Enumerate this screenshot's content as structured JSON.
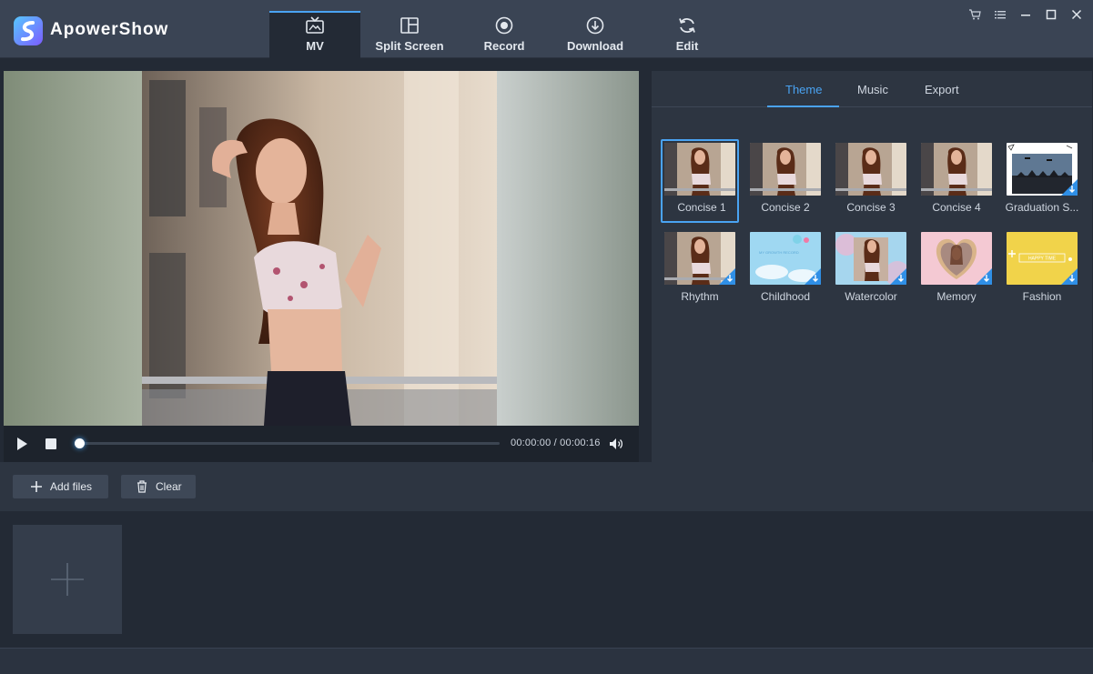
{
  "app": {
    "brand": "ApowerShow",
    "accent": "#4aa3f2"
  },
  "nav": {
    "tabs": [
      {
        "label": "MV",
        "icon": "tv-icon",
        "active": true
      },
      {
        "label": "Split Screen",
        "icon": "split-screen-icon",
        "active": false
      },
      {
        "label": "Record",
        "icon": "record-icon",
        "active": false
      },
      {
        "label": "Download",
        "icon": "download-icon",
        "active": false
      },
      {
        "label": "Edit",
        "icon": "refresh-icon",
        "active": false
      }
    ]
  },
  "window_controls": [
    "cart-icon",
    "menu-icon",
    "minimize-icon",
    "maximize-icon",
    "close-icon"
  ],
  "player": {
    "current_time": "00:00:00",
    "total_time": "00:00:16",
    "time_display": "00:00:00 / 00:00:16",
    "progress": 0
  },
  "panel": {
    "tabs": [
      {
        "label": "Theme",
        "active": true
      },
      {
        "label": "Music",
        "active": false
      },
      {
        "label": "Export",
        "active": false
      }
    ],
    "themes": [
      {
        "label": "Concise 1",
        "selected": true,
        "download": false
      },
      {
        "label": "Concise 2",
        "selected": false,
        "download": false
      },
      {
        "label": "Concise 3",
        "selected": false,
        "download": false
      },
      {
        "label": "Concise 4",
        "selected": false,
        "download": false
      },
      {
        "label": "Graduation S...",
        "selected": false,
        "download": true
      },
      {
        "label": "Rhythm",
        "selected": false,
        "download": true
      },
      {
        "label": "Childhood",
        "selected": false,
        "download": true
      },
      {
        "label": "Watercolor",
        "selected": false,
        "download": true
      },
      {
        "label": "Memory",
        "selected": false,
        "download": true
      },
      {
        "label": "Fashion",
        "selected": false,
        "download": true
      }
    ]
  },
  "thumb_text": {
    "childhood": "MY GROWTH RECORD",
    "fashion": "HAPPY TIME"
  },
  "toolbar": {
    "add_files": "Add files",
    "clear": "Clear"
  }
}
